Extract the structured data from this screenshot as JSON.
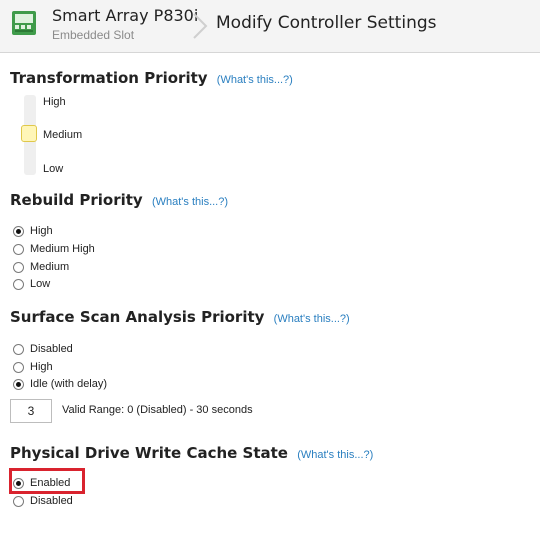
{
  "header": {
    "device_name": "Smart Array P830i",
    "device_slot": "Embedded Slot",
    "page_title": "Modify Controller Settings",
    "icon": "controller-icon"
  },
  "help_link": "(What's this...?)",
  "transformation": {
    "title": "Transformation Priority",
    "levels": [
      "High",
      "Medium",
      "Low"
    ],
    "selected": "Medium"
  },
  "rebuild": {
    "title": "Rebuild Priority",
    "options": [
      "High",
      "Medium High",
      "Medium",
      "Low"
    ],
    "selected": "High"
  },
  "surface_scan": {
    "title": "Surface Scan Analysis Priority",
    "options": [
      "Disabled",
      "High",
      "Idle (with delay)"
    ],
    "selected": "Idle (with delay)",
    "delay_value": "3",
    "range_text": "Valid Range: 0 (Disabled) - 30 seconds"
  },
  "write_cache": {
    "title": "Physical Drive Write Cache State",
    "options": [
      "Enabled",
      "Disabled"
    ],
    "selected": "Enabled"
  },
  "colors": {
    "link": "#2a7fc0",
    "highlight": "#d9232e",
    "slider_thumb": "#fff6b8"
  }
}
